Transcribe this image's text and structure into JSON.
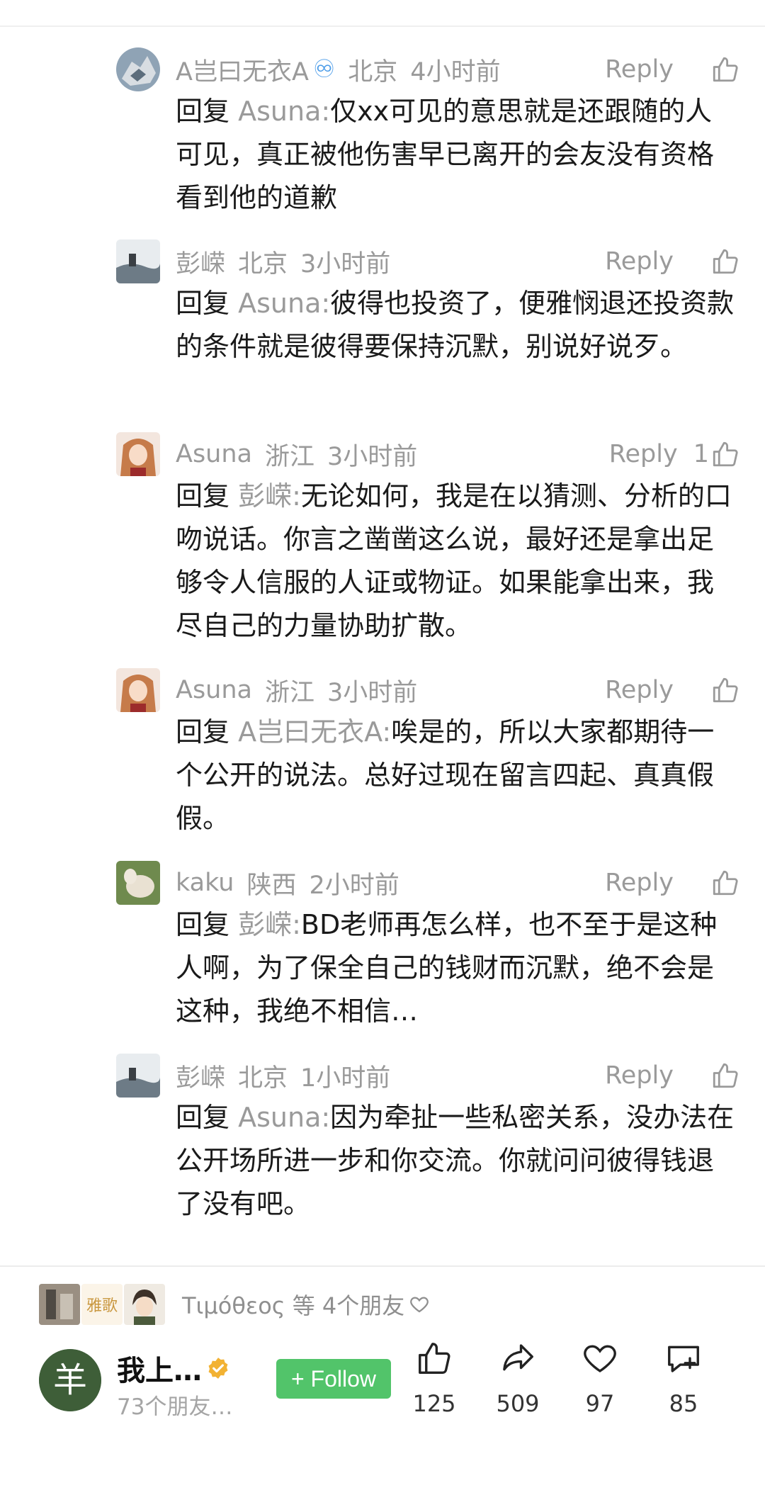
{
  "comments": [
    {
      "user": "A岂曰无衣A",
      "badge": "♾",
      "location": "北京",
      "time": "4小时前",
      "reply_label": "Reply",
      "like_count": "",
      "reply_prefix": "回复",
      "reply_to": "Asuna:",
      "text": "仅xx可见的意思就是还跟随的人可见，真正被他伤害早已离开的会友没有资格看到他的道歉"
    },
    {
      "user": "彭嵘",
      "location": "北京",
      "time": "3小时前",
      "reply_label": "Reply",
      "like_count": "",
      "reply_prefix": "回复",
      "reply_to": "Asuna:",
      "text": "彼得也投资了，便雅悯退还投资款的条件就是彼得要保持沉默，别说好说歹。"
    },
    {
      "user": "Asuna",
      "location": "浙江",
      "time": "3小时前",
      "reply_label": "Reply",
      "like_count": "1",
      "reply_prefix": "回复",
      "reply_to": "彭嵘:",
      "text": "无论如何，我是在以猜测、分析的口吻说话。你言之凿凿这么说，最好还是拿出足够令人信服的人证或物证。如果能拿出来，我尽自己的力量协助扩散。"
    },
    {
      "user": "Asuna",
      "location": "浙江",
      "time": "3小时前",
      "reply_label": "Reply",
      "like_count": "",
      "reply_prefix": "回复",
      "reply_to": "A岂曰无衣A:",
      "text": "唉是的，所以大家都期待一个公开的说法。总好过现在留言四起、真真假假。"
    },
    {
      "user": "kaku",
      "location": "陕西",
      "time": "2小时前",
      "reply_label": "Reply",
      "like_count": "",
      "reply_prefix": "回复",
      "reply_to": "彭嵘:",
      "text": "BD老师再怎么样，也不至于是这种人啊，为了保全自己的钱财而沉默，绝不会是这种，我绝不相信…"
    },
    {
      "user": "彭嵘",
      "location": "北京",
      "time": "1小时前",
      "reply_label": "Reply",
      "like_count": "",
      "reply_prefix": "回复",
      "reply_to": "Asuna:",
      "text": "因为牵扯一些私密关系，没办法在公开场所进一步和你交流。你就问问彼得钱退了没有吧。"
    }
  ],
  "friends": {
    "text": "Τιμόθεος 等 4个朋友",
    "badge_text": "雅歌"
  },
  "account": {
    "avatar_char": "羊",
    "name": "我上…",
    "subtitle": "73个朋友…",
    "follow_label": "+ Follow"
  },
  "actions": [
    {
      "icon": "thumbs-up-icon",
      "count": "125"
    },
    {
      "icon": "share-icon",
      "count": "509"
    },
    {
      "icon": "heart-icon",
      "count": "97"
    },
    {
      "icon": "comment-add-icon",
      "count": "85"
    }
  ],
  "colors": {
    "follow_bg": "#52c46a",
    "secondary_text": "#9a9a9a",
    "verified": "#f2b233"
  }
}
